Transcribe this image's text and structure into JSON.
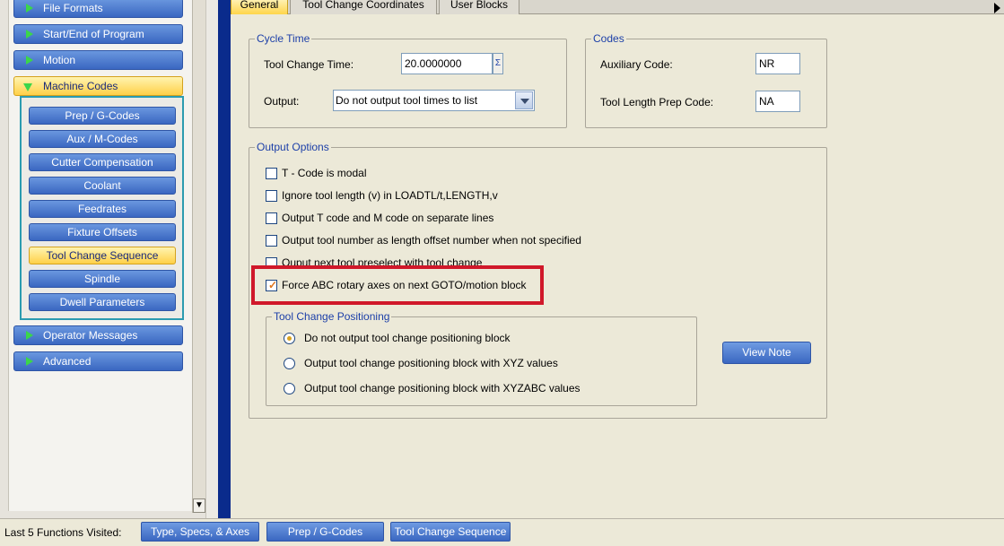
{
  "nav": {
    "items_top": [
      {
        "label": "File Formats",
        "active": false
      },
      {
        "label": "Start/End of Program",
        "active": false
      },
      {
        "label": "Motion",
        "active": false
      },
      {
        "label": "Machine Codes",
        "active": true
      }
    ],
    "sub_items": [
      {
        "label": "Prep / G-Codes",
        "active": false
      },
      {
        "label": "Aux / M-Codes",
        "active": false
      },
      {
        "label": "Cutter Compensation",
        "active": false
      },
      {
        "label": "Coolant",
        "active": false
      },
      {
        "label": "Feedrates",
        "active": false
      },
      {
        "label": "Fixture Offsets",
        "active": false
      },
      {
        "label": "Tool Change Sequence",
        "active": true
      },
      {
        "label": "Spindle",
        "active": false
      },
      {
        "label": "Dwell Parameters",
        "active": false
      }
    ],
    "items_bottom": [
      {
        "label": "Operator Messages",
        "active": false
      },
      {
        "label": "Advanced",
        "active": false
      }
    ]
  },
  "tabs": [
    {
      "label": "General",
      "active": true
    },
    {
      "label": "Tool Change Coordinates",
      "active": false
    },
    {
      "label": "User Blocks",
      "active": false
    }
  ],
  "cycle_time": {
    "title": "Cycle Time",
    "tool_change_time_label": "Tool Change Time:",
    "tool_change_time_value": "20.0000000",
    "sigma_glyph": "Σ",
    "output_label": "Output:",
    "output_value": "Do not output tool times to list"
  },
  "codes": {
    "title": "Codes",
    "auxiliary_label": "Auxiliary Code:",
    "auxiliary_value": "NR",
    "tool_length_label": "Tool Length Prep Code:",
    "tool_length_value": "NA"
  },
  "output_options": {
    "title": "Output Options",
    "checkboxes": [
      {
        "label": "T - Code is modal",
        "checked": false
      },
      {
        "label": "Ignore tool length (v) in LOADTL/t,LENGTH,v",
        "checked": false
      },
      {
        "label": "Output T code and M code on separate lines",
        "checked": false
      },
      {
        "label": "Output tool number as length offset number when not specified",
        "checked": false
      },
      {
        "label": "Ouput next tool preselect with tool change",
        "checked": false
      },
      {
        "label": "Force ABC rotary axes on next GOTO/motion block",
        "checked": true
      }
    ],
    "check_glyph": "✓"
  },
  "tool_change_positioning": {
    "title": "Tool Change Positioning",
    "options": [
      {
        "label": "Do not output tool change positioning block",
        "selected": true
      },
      {
        "label": "Output tool change positioning block with XYZ values",
        "selected": false
      },
      {
        "label": "Output tool change positioning block with XYZABC values",
        "selected": false
      }
    ]
  },
  "view_note_label": "View Note",
  "bottom_bar": {
    "label": "Last 5 Functions Visited:",
    "recent": [
      "Type, Specs, & Axes",
      "Prep / G-Codes",
      "Tool Change Sequence"
    ]
  },
  "colors": {
    "accent_blue": "#3a67c1",
    "active_yellow": "#ffd048",
    "highlight_red": "#d0182a",
    "group_title": "#1c3fa8"
  }
}
